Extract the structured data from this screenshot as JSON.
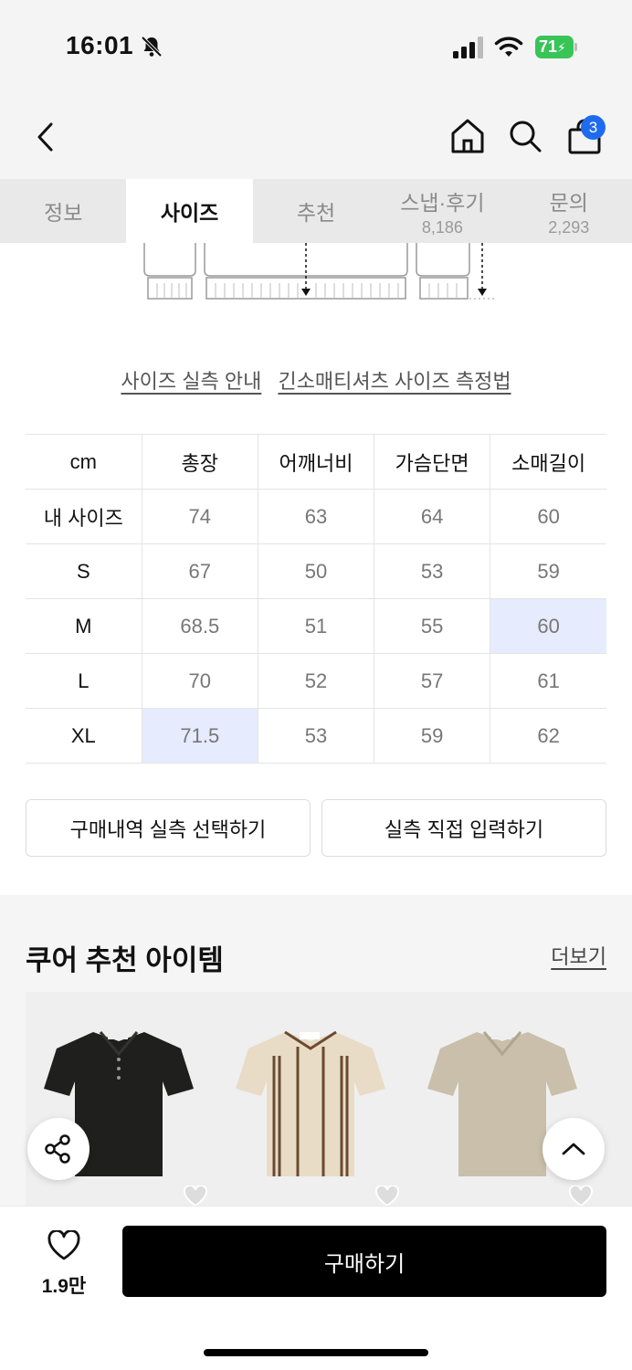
{
  "status_bar": {
    "time": "16:01",
    "battery": "71"
  },
  "header": {
    "cart_count": "3"
  },
  "tabs": [
    {
      "label": "정보",
      "count": ""
    },
    {
      "label": "사이즈",
      "count": ""
    },
    {
      "label": "추천",
      "count": ""
    },
    {
      "label": "스냅·후기",
      "count": "8,186"
    },
    {
      "label": "문의",
      "count": "2,293"
    }
  ],
  "active_tab": "사이즈",
  "guide_links": {
    "measure_guide": "사이즈 실측 안내",
    "method": "긴소매티셔츠 사이즈 측정법"
  },
  "size_table": {
    "headers": [
      "cm",
      "총장",
      "어깨너비",
      "가슴단면",
      "소매길이"
    ],
    "rows": [
      [
        "내 사이즈",
        "74",
        "63",
        "64",
        "60"
      ],
      [
        "S",
        "67",
        "50",
        "53",
        "59"
      ],
      [
        "M",
        "68.5",
        "51",
        "55",
        "60"
      ],
      [
        "L",
        "70",
        "52",
        "57",
        "61"
      ],
      [
        "XL",
        "71.5",
        "53",
        "59",
        "62"
      ]
    ]
  },
  "buttons": {
    "purchase_history": "구매내역 실측 선택하기",
    "manual_input": "실측 직접 입력하기"
  },
  "recommendation": {
    "title": "쿠어 추천 아이템",
    "more": "더보기"
  },
  "bottom_bar": {
    "like_count": "1.9만",
    "buy": "구매하기"
  },
  "colors": {
    "accent": "#1e6bf0",
    "highlight": "#e6ecfd",
    "battery": "#39c457"
  }
}
